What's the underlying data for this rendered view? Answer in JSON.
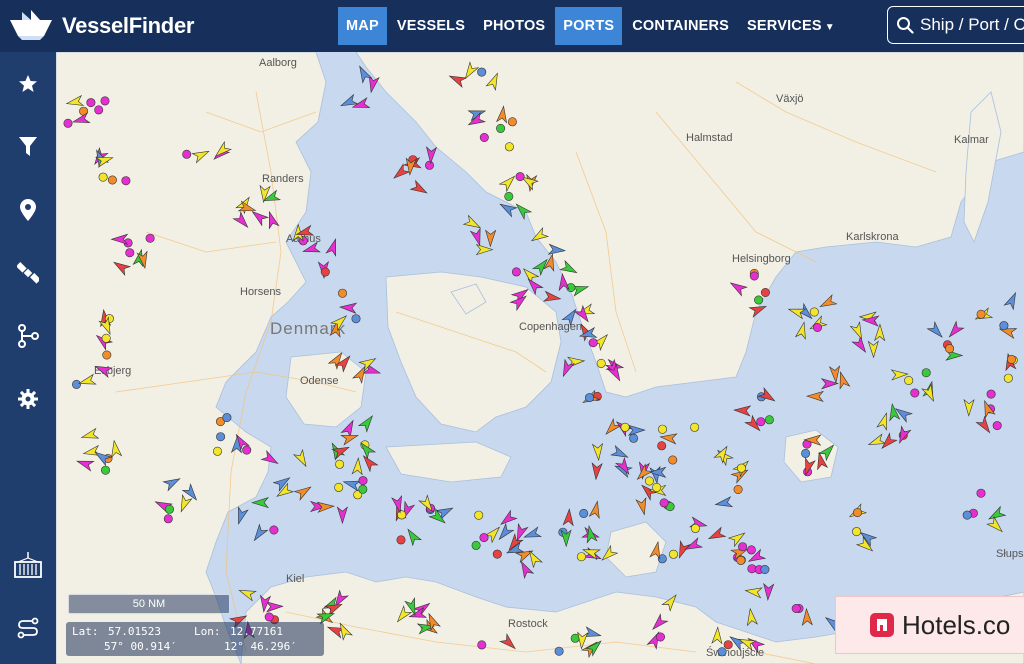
{
  "brand": {
    "name": "VesselFinder"
  },
  "nav": {
    "map": "MAP",
    "vessels": "VESSELS",
    "photos": "PHOTOS",
    "ports": "PORTS",
    "containers": "CONTAINERS",
    "services": "SERVICES"
  },
  "search": {
    "placeholder": "Ship / Port / Co"
  },
  "sidebar": [
    "star-icon",
    "filter-icon",
    "map-pin-icon",
    "satellite-icon",
    "route-icon",
    "gear-icon",
    "container-icon",
    "swap-route-icon"
  ],
  "map": {
    "cities": [
      "Aalborg",
      "Randers",
      "Aarhus",
      "Horsens",
      "Denmark",
      "Esbjerg",
      "Odense",
      "Halmstad",
      "Helsingborg",
      "Copenhagen",
      "Växjö",
      "Kalmar",
      "Karlskrona",
      "Kiel",
      "Rostock",
      "Świnoujście",
      "Słupsk"
    ],
    "scale": "50 NM",
    "coords": {
      "lat_label": "Lat:",
      "lat": "57.01523",
      "lat_dms": "57° 00.914′",
      "lon_label": "Lon:",
      "lon": "12.77161",
      "lon_dms": "12° 46.296′"
    }
  },
  "ad": {
    "text": "Hotels.co"
  },
  "colors": {
    "topbar": "#17305b",
    "sidebar": "#1f3e6e",
    "active": "#3d85d6",
    "land": "#f2efe4",
    "sea": "#c8d8ee"
  }
}
